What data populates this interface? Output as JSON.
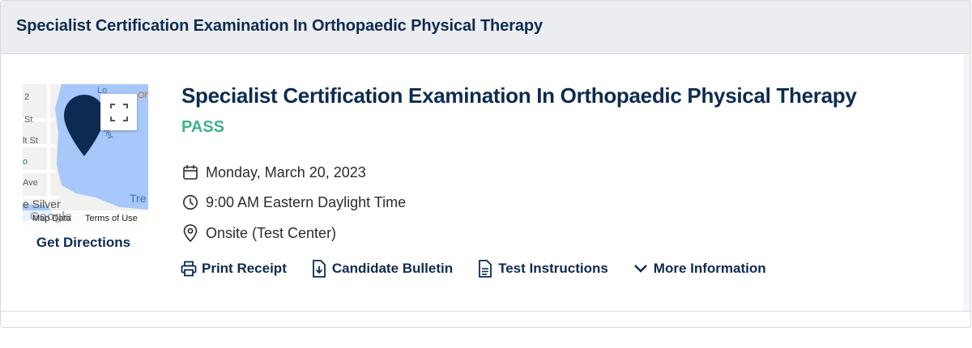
{
  "header": {
    "title": "Specialist Certification Examination In Orthopaedic Physical Therapy"
  },
  "map": {
    "street_labels": [
      "St",
      "lt St",
      "Ave",
      "e Silver",
      "Tre",
      "Lo",
      "ver",
      "o",
      "Ohio",
      "2"
    ],
    "attribution": "Map Data",
    "terms": "Terms of Use",
    "logo_text": "Google",
    "get_directions": "Get Directions",
    "water_color": "#a8c7fa",
    "pin_color": "#0d2b52"
  },
  "exam": {
    "title": "Specialist Certification Examination In Orthopaedic Physical Therapy",
    "status": "PASS",
    "status_color": "#3db38a",
    "date": "Monday, March 20, 2023",
    "time": "9:00 AM Eastern Daylight Time",
    "location": "Onsite (Test Center)"
  },
  "actions": {
    "print_receipt": "Print Receipt",
    "candidate_bulletin": "Candidate Bulletin",
    "test_instructions": "Test Instructions",
    "more_information": "More Information"
  },
  "icons": {
    "date": "calendar-icon",
    "time": "clock-icon",
    "location": "map-pin-icon",
    "print": "printer-icon",
    "bulletin": "download-document-icon",
    "instructions": "document-icon",
    "more": "chevron-down-icon",
    "fullscreen": "fullscreen-icon"
  },
  "colors": {
    "brand_navy": "#0d2b52",
    "header_bg": "#ecedf0"
  }
}
